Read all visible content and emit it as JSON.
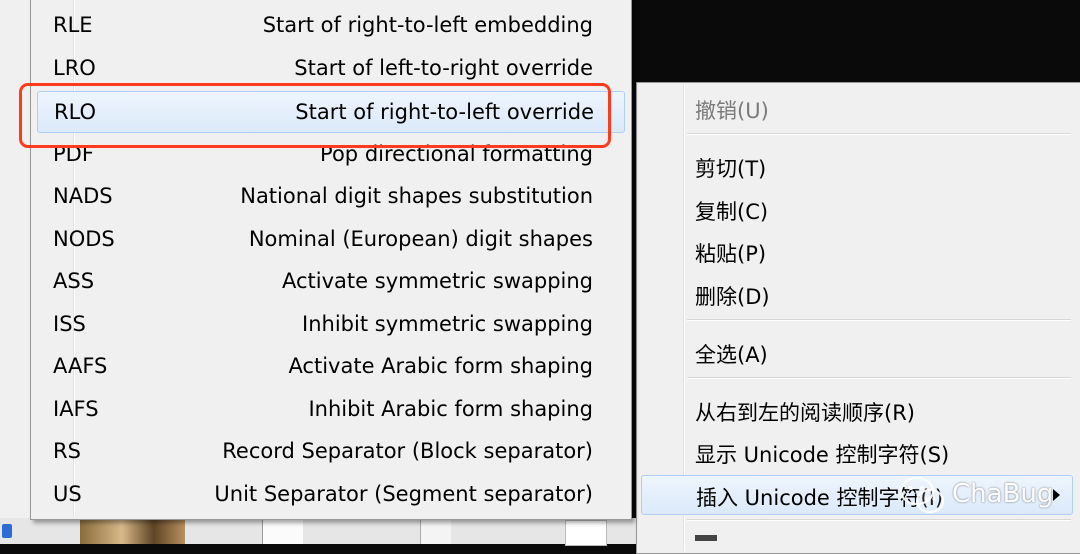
{
  "submenu": {
    "items": [
      {
        "code": "RLE",
        "desc": "Start of right-to-left embedding"
      },
      {
        "code": "LRO",
        "desc": "Start of left-to-right override"
      },
      {
        "code": "RLO",
        "desc": "Start of right-to-left override",
        "highlighted": true
      },
      {
        "code": "PDF",
        "desc": "Pop directional formatting"
      },
      {
        "code": "NADS",
        "desc": "National digit shapes substitution"
      },
      {
        "code": "NODS",
        "desc": "Nominal (European) digit shapes"
      },
      {
        "code": "ASS",
        "desc": "Activate symmetric swapping"
      },
      {
        "code": "ISS",
        "desc": "Inhibit symmetric swapping"
      },
      {
        "code": "AAFS",
        "desc": "Activate Arabic form shaping"
      },
      {
        "code": "IAFS",
        "desc": "Inhibit Arabic form shaping"
      },
      {
        "code": "RS",
        "desc": "Record Separator (Block separator)"
      },
      {
        "code": "US",
        "desc": "Unit Separator (Segment separator)"
      }
    ]
  },
  "context_menu": {
    "items": [
      {
        "label": "撤销(U)",
        "disabled": true
      },
      {
        "label": "剪切(T)"
      },
      {
        "label": "复制(C)"
      },
      {
        "label": "粘贴(P)"
      },
      {
        "label": "删除(D)"
      },
      {
        "label": "全选(A)"
      },
      {
        "label": "从右到左的阅读顺序(R)"
      },
      {
        "label": "显示 Unicode 控制字符(S)"
      },
      {
        "label": "插入 Unicode 控制字符(I)",
        "highlighted": true,
        "has_submenu": true
      }
    ]
  },
  "watermark": {
    "text": "ChaBug",
    "icon": "wechat-icon"
  },
  "colors": {
    "highlight_border": "#ff3b1e",
    "menu_bg": "#f0f0f0",
    "hover_bg": "#dbe9f9"
  }
}
